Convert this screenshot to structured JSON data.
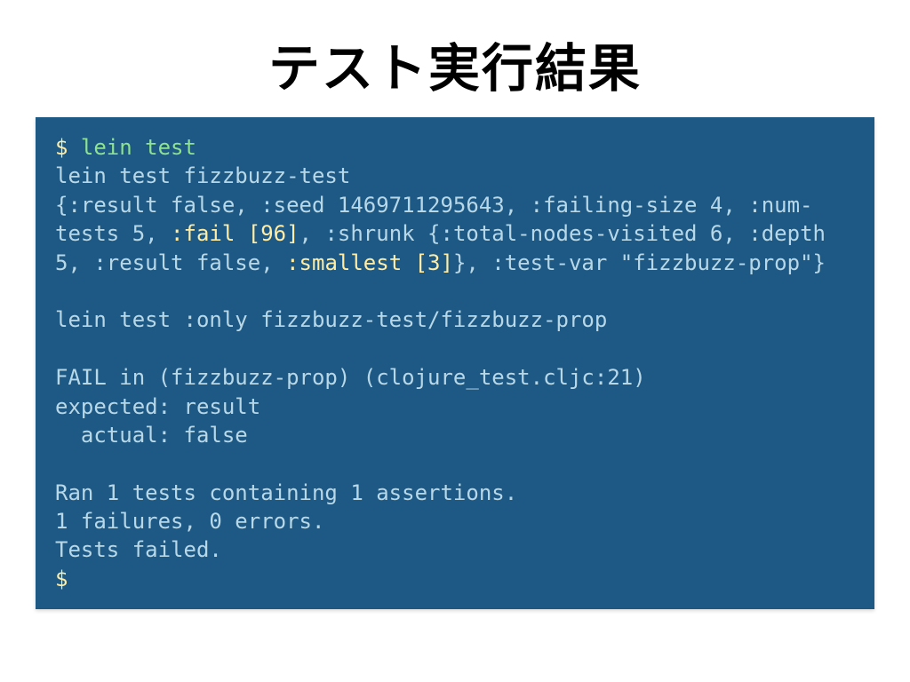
{
  "title": "テスト実行結果",
  "terminal": {
    "p1": "$ ",
    "cmd": "lein test",
    "l1": "lein test fizzbuzz-test",
    "l2a": "{:result false, :seed 1469711295643, :failing-size 4, :num-tests 5, ",
    "fail": ":fail [96]",
    "l2b": ", :shrunk {:total-nodes-visited 6, :depth 5, :result false, ",
    "smallest": ":smallest [3]",
    "l2c": "}, :test-var \"fizzbuzz-prop\"}",
    "l3": "lein test :only fizzbuzz-test/fizzbuzz-prop",
    "l4": "FAIL in (fizzbuzz-prop) (clojure_test.cljc:21)",
    "l5": "expected: result",
    "l6": "  actual: false",
    "l7": "Ran 1 tests containing 1 assertions.",
    "l8": "1 failures, 0 errors.",
    "l9": "Tests failed.",
    "p2": "$"
  }
}
